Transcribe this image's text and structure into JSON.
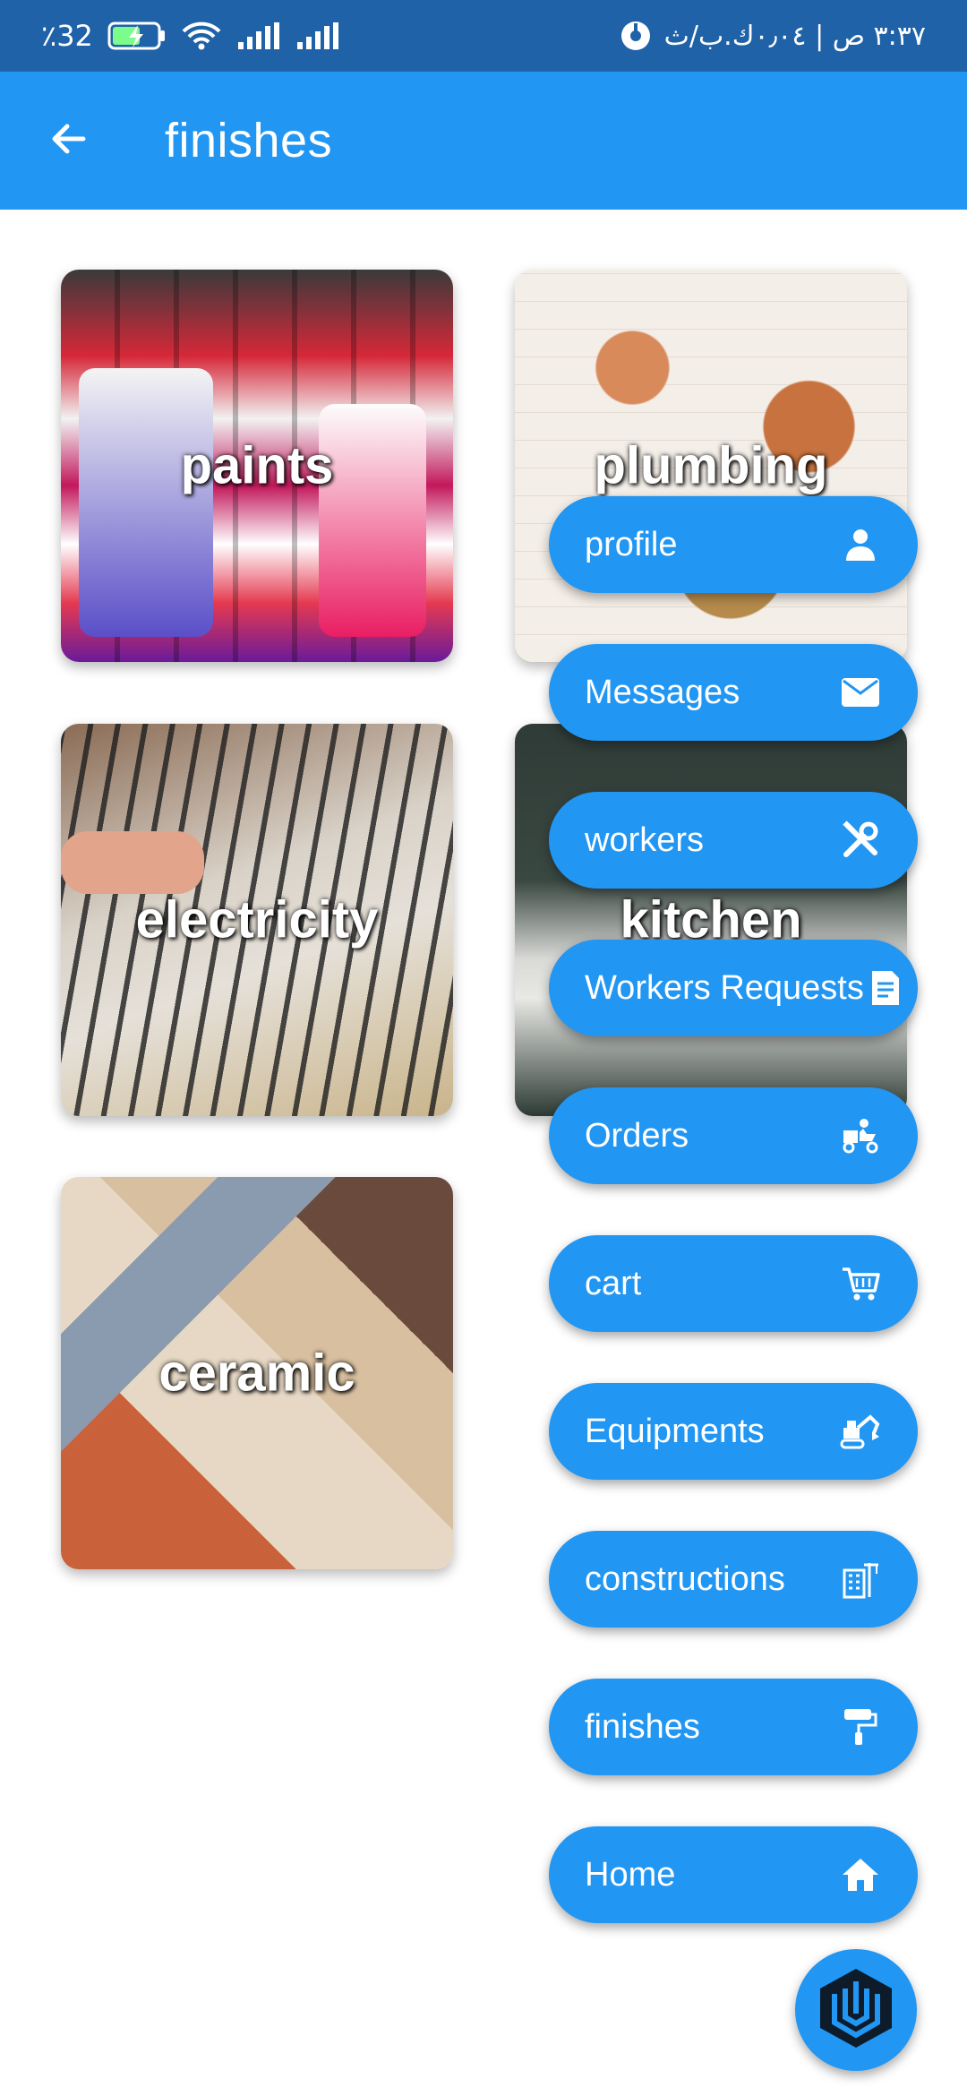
{
  "status_bar": {
    "battery_percent": "٪32",
    "time_text": "٣:٣٧ ص | ٠٫٠٤ك.ب/ث"
  },
  "app_bar": {
    "title": "finishes",
    "back_icon": "arrow-left-icon"
  },
  "categories": [
    {
      "label": "paints"
    },
    {
      "label": "plumbing"
    },
    {
      "label": "electricity"
    },
    {
      "label": "kitchen"
    },
    {
      "label": "ceramic"
    }
  ],
  "speed_dial": [
    {
      "label": "profile",
      "icon": "person-icon"
    },
    {
      "label": "Messages",
      "icon": "mail-icon"
    },
    {
      "label": "workers",
      "icon": "tools-icon"
    },
    {
      "label": "Workers Requests",
      "icon": "document-icon"
    },
    {
      "label": "Orders",
      "icon": "delivery-icon"
    },
    {
      "label": "cart",
      "icon": "cart-icon"
    },
    {
      "label": "Equipments",
      "icon": "excavator-icon"
    },
    {
      "label": "constructions",
      "icon": "building-crane-icon"
    },
    {
      "label": "finishes",
      "icon": "paint-roller-icon"
    },
    {
      "label": "Home",
      "icon": "home-icon"
    }
  ],
  "fab": {
    "icon": "app-logo-icon"
  },
  "colors": {
    "primary": "#2196f3",
    "status_bar": "#1f62a8",
    "fab_logo": "#0d1b2a"
  }
}
